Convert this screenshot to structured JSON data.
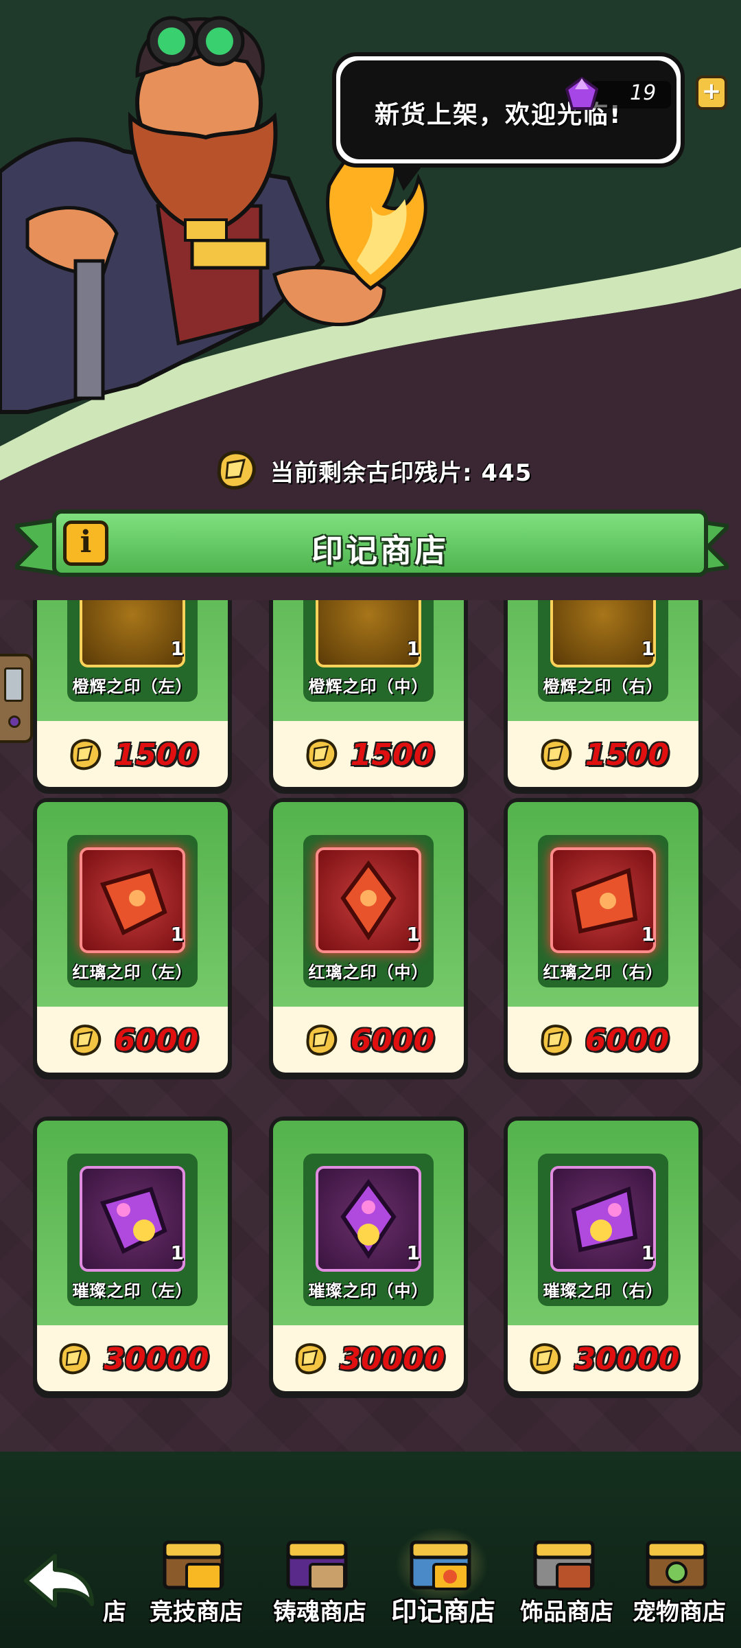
{
  "header": {
    "speech": "新货上架，欢迎光临!",
    "gem_count": "19",
    "gem_icon": "purple-gem-icon",
    "plus_label": "+"
  },
  "fragments": {
    "label": "当前剩余古印残片: 445",
    "icon": "gold-fragment-icon"
  },
  "banner": {
    "title": "印记商店",
    "info_label": "i"
  },
  "shop": {
    "rows": [
      {
        "tier": "gold",
        "items": [
          {
            "name": "橙辉之印（左）",
            "qty": "1",
            "price": "1500"
          },
          {
            "name": "橙辉之印（中）",
            "qty": "1",
            "price": "1500"
          },
          {
            "name": "橙辉之印（右）",
            "qty": "1",
            "price": "1500"
          }
        ]
      },
      {
        "tier": "red",
        "items": [
          {
            "name": "红璃之印（左）",
            "qty": "1",
            "price": "6000"
          },
          {
            "name": "红璃之印（中）",
            "qty": "1",
            "price": "6000"
          },
          {
            "name": "红璃之印（右）",
            "qty": "1",
            "price": "6000"
          }
        ]
      },
      {
        "tier": "purple",
        "items": [
          {
            "name": "璀璨之印（左）",
            "qty": "1",
            "price": "30000"
          },
          {
            "name": "璀璨之印（中）",
            "qty": "1",
            "price": "30000"
          },
          {
            "name": "璀璨之印（右）",
            "qty": "1",
            "price": "30000"
          }
        ]
      }
    ]
  },
  "nav": {
    "partial_label": "店",
    "items": [
      {
        "label": "竞技商店",
        "icon": "arena-chest-icon"
      },
      {
        "label": "铸魂商店",
        "icon": "soul-chest-icon"
      },
      {
        "label": "印记商店",
        "icon": "seal-chest-icon",
        "active": true
      },
      {
        "label": "饰品商店",
        "icon": "accessory-chest-icon"
      },
      {
        "label": "宠物商店",
        "icon": "pet-chest-icon"
      }
    ]
  },
  "colors": {
    "price_red": "#e11010",
    "card_green": "#54b34c",
    "banner_green": "#7ee07e",
    "bg_plum": "#3a2733"
  }
}
